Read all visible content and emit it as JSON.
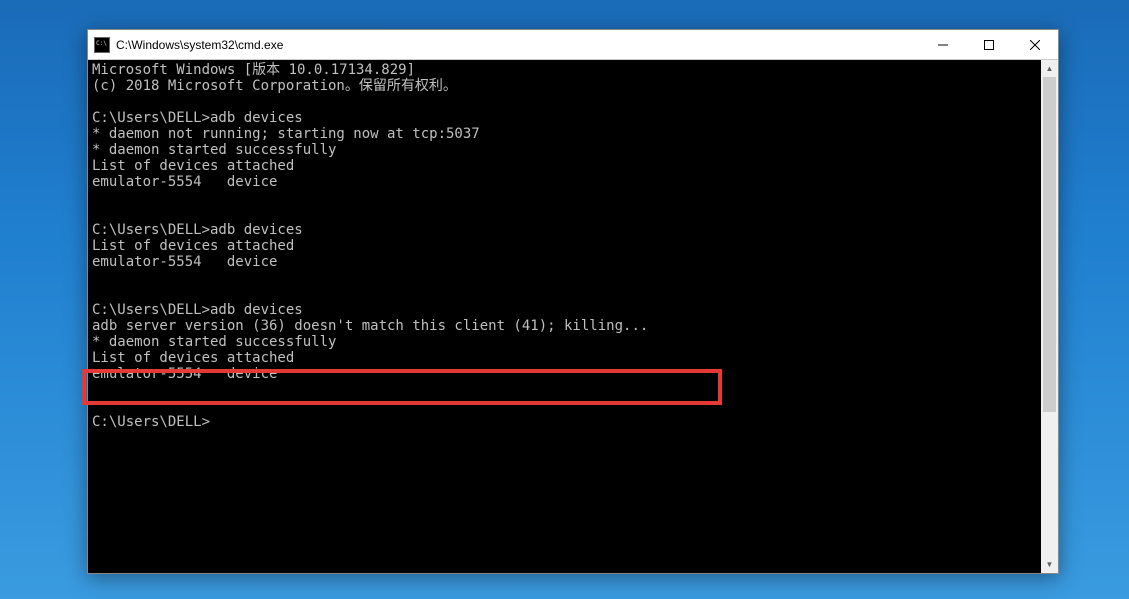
{
  "window": {
    "title": "C:\\Windows\\system32\\cmd.exe"
  },
  "terminal": {
    "lines": [
      "Microsoft Windows [版本 10.0.17134.829]",
      "(c) 2018 Microsoft Corporation。保留所有权利。",
      "",
      "C:\\Users\\DELL>adb devices",
      "* daemon not running; starting now at tcp:5037",
      "* daemon started successfully",
      "List of devices attached",
      "emulator-5554   device",
      "",
      "",
      "C:\\Users\\DELL>adb devices",
      "List of devices attached",
      "emulator-5554   device",
      "",
      "",
      "C:\\Users\\DELL>adb devices",
      "adb server version (36) doesn't match this client (41); killing...",
      "* daemon started successfully",
      "List of devices attached",
      "emulator-5554   device",
      "",
      "",
      "C:\\Users\\DELL>"
    ],
    "highlighted_line": "adb server version (36) doesn't match this client (41); killing..."
  }
}
